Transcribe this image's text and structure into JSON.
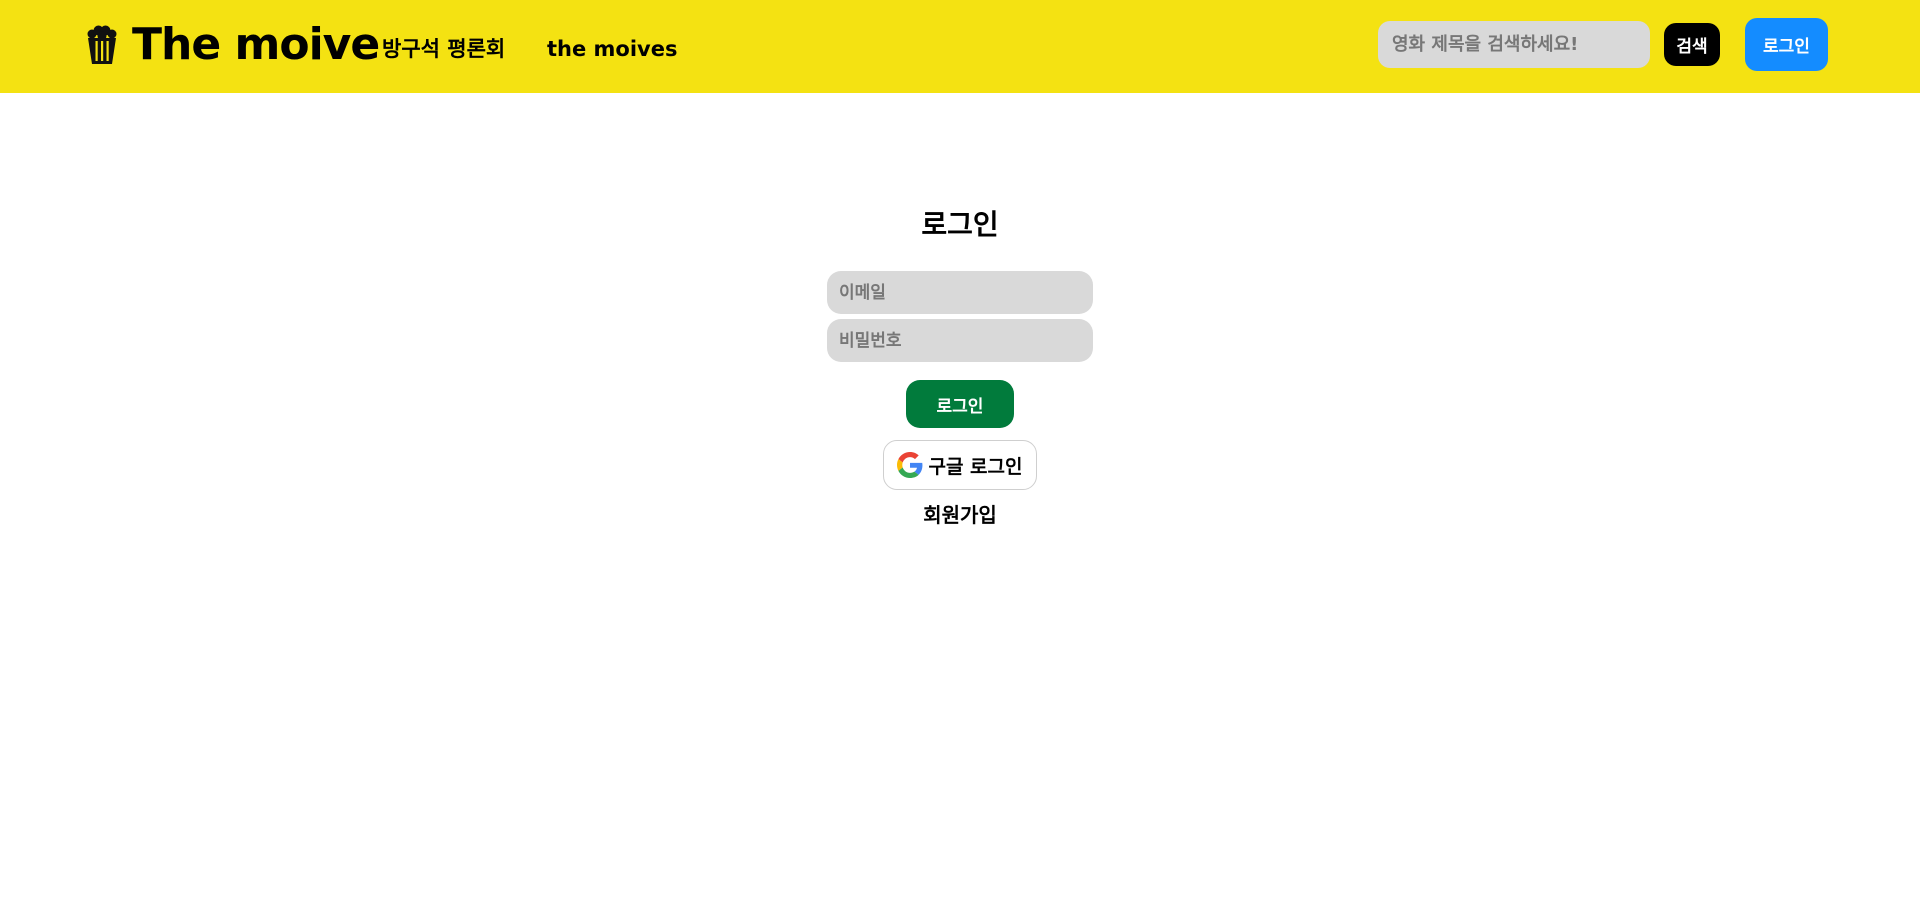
{
  "header": {
    "logo_text": "The moive",
    "logo_icon": "popcorn-icon",
    "nav": [
      {
        "label": "방구석 평론회"
      },
      {
        "label": "the moives"
      }
    ],
    "search": {
      "placeholder": "영화 제목을 검색하세요!",
      "button_label": "검색"
    },
    "login_button_label": "로그인",
    "colors": {
      "background": "#f4e212",
      "login_button": "#148cff",
      "search_button": "#000000"
    }
  },
  "login_form": {
    "title": "로그인",
    "email_placeholder": "이메일",
    "password_placeholder": "비밀번호",
    "submit_label": "로그인",
    "google_label": "구글 로그인",
    "google_icon": "google-icon",
    "signup_label": "회원가입",
    "colors": {
      "submit_button": "#017b3c",
      "field_background": "#d9d9d9"
    }
  }
}
